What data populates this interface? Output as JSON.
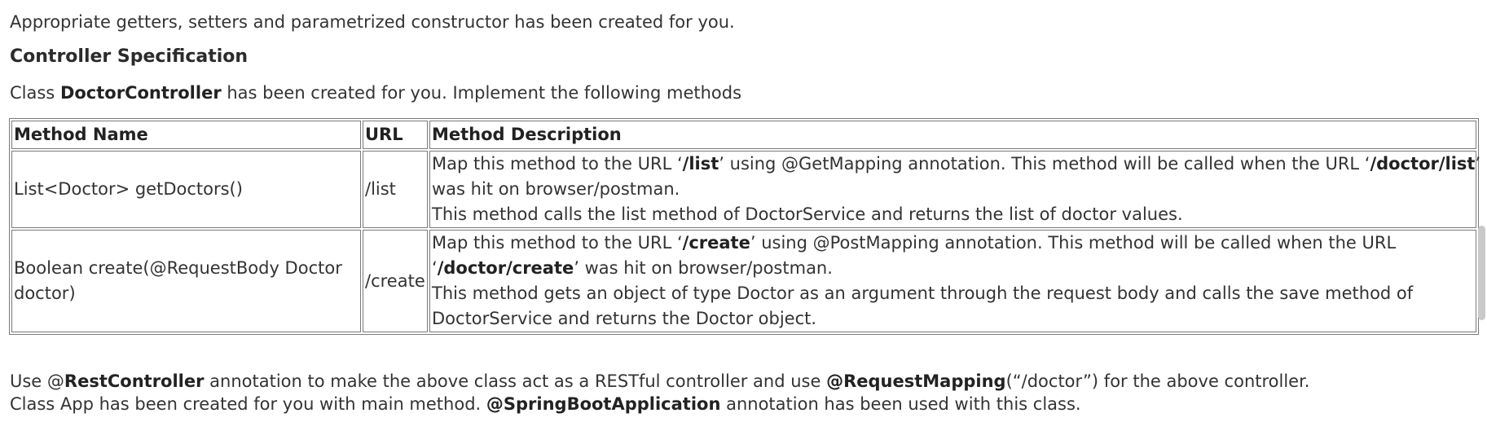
{
  "intro": "Appropriate getters, setters and parametrized constructor has been created for you.",
  "controller_heading": "Controller Specification",
  "class_line": {
    "prefix": "Class ",
    "class_name": "DoctorController",
    "suffix": " has been created for you. Implement the following methods"
  },
  "table": {
    "headers": [
      "Method Name",
      "URL",
      "Method Description"
    ],
    "rows": [
      {
        "method": "List<Doctor> getDoctors()",
        "url": "/list",
        "desc1": {
          "a": "Map this method to the URL ‘",
          "b": "/list",
          "c": "’ using @GetMapping annotation. This method will be called when the URL ‘",
          "d": "/doctor/list",
          "e": "’"
        },
        "desc2": "was hit on browser/postman.",
        "desc3": "This method calls the list method of DoctorService and returns the list of doctor values."
      },
      {
        "method": "Boolean create(@RequestBody Doctor doctor)",
        "url": "/create",
        "desc1": "Map this method to the URL ‘/create’ using @PostMapping annotation. This method will be called when the URL",
        "desc1_parts": {
          "a": "Map this method to the URL ‘",
          "b": "/create",
          "c": "’ using @PostMapping annotation. This method will be called when the URL"
        },
        "desc2": {
          "a": "‘",
          "b": "/doctor/create",
          "c": "’ was hit on browser/postman."
        },
        "desc3": "This method gets an object of type Doctor as an argument through the request body and calls the save method of",
        "desc4": "DoctorService and returns the Doctor object."
      }
    ]
  },
  "use_line": {
    "a": "Use @",
    "b": "RestController",
    "c": " annotation to make the above class act as a RESTful controller and use ",
    "d": "@RequestMapping",
    "e": "(“/doctor”) for the above controller."
  },
  "app_line": {
    "a": "Class App has been created for you with main method. ",
    "b": "@SpringBootApplication",
    "c": " annotation has been used with this class."
  }
}
